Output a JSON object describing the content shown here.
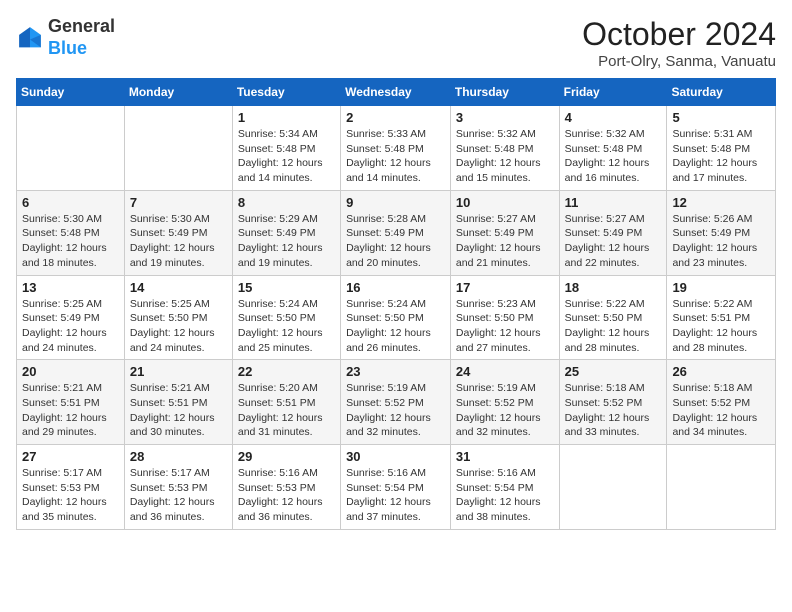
{
  "header": {
    "logo_line1": "General",
    "logo_line2": "Blue",
    "month_title": "October 2024",
    "location": "Port-Olry, Sanma, Vanuatu"
  },
  "weekdays": [
    "Sunday",
    "Monday",
    "Tuesday",
    "Wednesday",
    "Thursday",
    "Friday",
    "Saturday"
  ],
  "weeks": [
    [
      {
        "day": "",
        "info": ""
      },
      {
        "day": "",
        "info": ""
      },
      {
        "day": "1",
        "info": "Sunrise: 5:34 AM\nSunset: 5:48 PM\nDaylight: 12 hours and 14 minutes."
      },
      {
        "day": "2",
        "info": "Sunrise: 5:33 AM\nSunset: 5:48 PM\nDaylight: 12 hours and 14 minutes."
      },
      {
        "day": "3",
        "info": "Sunrise: 5:32 AM\nSunset: 5:48 PM\nDaylight: 12 hours and 15 minutes."
      },
      {
        "day": "4",
        "info": "Sunrise: 5:32 AM\nSunset: 5:48 PM\nDaylight: 12 hours and 16 minutes."
      },
      {
        "day": "5",
        "info": "Sunrise: 5:31 AM\nSunset: 5:48 PM\nDaylight: 12 hours and 17 minutes."
      }
    ],
    [
      {
        "day": "6",
        "info": "Sunrise: 5:30 AM\nSunset: 5:48 PM\nDaylight: 12 hours and 18 minutes."
      },
      {
        "day": "7",
        "info": "Sunrise: 5:30 AM\nSunset: 5:49 PM\nDaylight: 12 hours and 19 minutes."
      },
      {
        "day": "8",
        "info": "Sunrise: 5:29 AM\nSunset: 5:49 PM\nDaylight: 12 hours and 19 minutes."
      },
      {
        "day": "9",
        "info": "Sunrise: 5:28 AM\nSunset: 5:49 PM\nDaylight: 12 hours and 20 minutes."
      },
      {
        "day": "10",
        "info": "Sunrise: 5:27 AM\nSunset: 5:49 PM\nDaylight: 12 hours and 21 minutes."
      },
      {
        "day": "11",
        "info": "Sunrise: 5:27 AM\nSunset: 5:49 PM\nDaylight: 12 hours and 22 minutes."
      },
      {
        "day": "12",
        "info": "Sunrise: 5:26 AM\nSunset: 5:49 PM\nDaylight: 12 hours and 23 minutes."
      }
    ],
    [
      {
        "day": "13",
        "info": "Sunrise: 5:25 AM\nSunset: 5:49 PM\nDaylight: 12 hours and 24 minutes."
      },
      {
        "day": "14",
        "info": "Sunrise: 5:25 AM\nSunset: 5:50 PM\nDaylight: 12 hours and 24 minutes."
      },
      {
        "day": "15",
        "info": "Sunrise: 5:24 AM\nSunset: 5:50 PM\nDaylight: 12 hours and 25 minutes."
      },
      {
        "day": "16",
        "info": "Sunrise: 5:24 AM\nSunset: 5:50 PM\nDaylight: 12 hours and 26 minutes."
      },
      {
        "day": "17",
        "info": "Sunrise: 5:23 AM\nSunset: 5:50 PM\nDaylight: 12 hours and 27 minutes."
      },
      {
        "day": "18",
        "info": "Sunrise: 5:22 AM\nSunset: 5:50 PM\nDaylight: 12 hours and 28 minutes."
      },
      {
        "day": "19",
        "info": "Sunrise: 5:22 AM\nSunset: 5:51 PM\nDaylight: 12 hours and 28 minutes."
      }
    ],
    [
      {
        "day": "20",
        "info": "Sunrise: 5:21 AM\nSunset: 5:51 PM\nDaylight: 12 hours and 29 minutes."
      },
      {
        "day": "21",
        "info": "Sunrise: 5:21 AM\nSunset: 5:51 PM\nDaylight: 12 hours and 30 minutes."
      },
      {
        "day": "22",
        "info": "Sunrise: 5:20 AM\nSunset: 5:51 PM\nDaylight: 12 hours and 31 minutes."
      },
      {
        "day": "23",
        "info": "Sunrise: 5:19 AM\nSunset: 5:52 PM\nDaylight: 12 hours and 32 minutes."
      },
      {
        "day": "24",
        "info": "Sunrise: 5:19 AM\nSunset: 5:52 PM\nDaylight: 12 hours and 32 minutes."
      },
      {
        "day": "25",
        "info": "Sunrise: 5:18 AM\nSunset: 5:52 PM\nDaylight: 12 hours and 33 minutes."
      },
      {
        "day": "26",
        "info": "Sunrise: 5:18 AM\nSunset: 5:52 PM\nDaylight: 12 hours and 34 minutes."
      }
    ],
    [
      {
        "day": "27",
        "info": "Sunrise: 5:17 AM\nSunset: 5:53 PM\nDaylight: 12 hours and 35 minutes."
      },
      {
        "day": "28",
        "info": "Sunrise: 5:17 AM\nSunset: 5:53 PM\nDaylight: 12 hours and 36 minutes."
      },
      {
        "day": "29",
        "info": "Sunrise: 5:16 AM\nSunset: 5:53 PM\nDaylight: 12 hours and 36 minutes."
      },
      {
        "day": "30",
        "info": "Sunrise: 5:16 AM\nSunset: 5:54 PM\nDaylight: 12 hours and 37 minutes."
      },
      {
        "day": "31",
        "info": "Sunrise: 5:16 AM\nSunset: 5:54 PM\nDaylight: 12 hours and 38 minutes."
      },
      {
        "day": "",
        "info": ""
      },
      {
        "day": "",
        "info": ""
      }
    ]
  ]
}
